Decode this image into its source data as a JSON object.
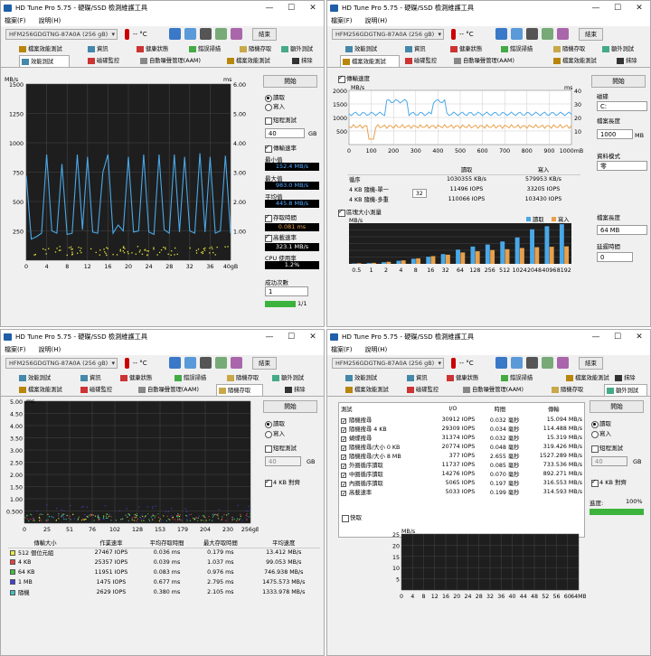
{
  "app": {
    "title": "HD Tune Pro 5.75 - 硬碟/SSD 檢測維護工具",
    "menu": [
      "檔案(F)",
      "說明(H)"
    ],
    "drive": "HFM256GDGTNG-87A0A (256 gB)",
    "temp": "-- °C",
    "exit_label": "結束"
  },
  "tabs": [
    "檔案效能測試",
    "資訊",
    "健康狀態",
    "錯誤掃描",
    "隨機存取",
    "額外測試",
    "效能測試",
    "磁碟監控",
    "自動噪聲管理(AAM)",
    "抹除"
  ],
  "colors": {
    "read": "#4aa8e8",
    "write": "#e8a04a",
    "bg": "#1e1e1e"
  },
  "win1": {
    "y_unit": "MB/s",
    "y2_unit": "ms",
    "yticks": [
      "1500",
      "1250",
      "1000",
      "750",
      "500",
      "250"
    ],
    "y2ticks": [
      "6.00",
      "5.00",
      "4.00",
      "3.00",
      "2.00",
      "1.00"
    ],
    "xticks": [
      "0",
      "4",
      "8",
      "12",
      "16",
      "20",
      "24",
      "28",
      "32",
      "36",
      "40gB"
    ],
    "start": "開始",
    "read": "讀取",
    "write": "寫入",
    "short": "短程測試",
    "short_val": "40",
    "short_unit": "GB",
    "transfer": "傳輸速率",
    "min_label": "最小值",
    "min": "152.4 MB/s",
    "max_label": "最大值",
    "max": "983.0 MB/s",
    "avg_label": "平均值",
    "avg": "445.8 MB/s",
    "access_label": "存取時間",
    "access": "0.081 ms",
    "burst_label": "高載速率",
    "burst": "323.1 MB/s",
    "cpu_label": "CPU 使用率",
    "cpu": "1.2%",
    "passes_label": "成功次數",
    "passes": "1",
    "progress": "1/1"
  },
  "win2": {
    "transfer": "傳輸速度",
    "y_unit": "MB/s",
    "y2_unit": "ms",
    "yticks": [
      "2000",
      "1500",
      "1000",
      "500"
    ],
    "y2ticks": [
      "40",
      "30",
      "20",
      "10"
    ],
    "xticks": [
      "0",
      "100",
      "200",
      "300",
      "400",
      "500",
      "600",
      "700",
      "800",
      "900",
      "1000mB"
    ],
    "table": {
      "headers": [
        "",
        "讀取",
        "寫入"
      ],
      "rows": [
        [
          "循序",
          "1030355 KB/s",
          "579953 KB/s"
        ],
        [
          "4 KB 隨機-單一",
          "11496 IOPS",
          "33205 IOPS"
        ],
        [
          "4 KB 隨機-多重",
          "110066 IOPS",
          "103430 IOPS"
        ]
      ],
      "queue": "32"
    },
    "block": "區塊大小測量",
    "bar_unit": "MB/s",
    "legend": [
      "讀取",
      "寫入"
    ],
    "categories": [
      "0.5",
      "1",
      "2",
      "4",
      "8",
      "16",
      "32",
      "64",
      "128",
      "256",
      "512",
      "1024",
      "2048",
      "4096",
      "8192"
    ],
    "start": "開始",
    "disk_label": "磁碟",
    "disk": "C:",
    "len_label": "檔案長度",
    "len": "1000",
    "len_unit": "MB",
    "mode_label": "資料模式",
    "mode": "零",
    "blk_label": "檔案長度",
    "blk": "64 MB",
    "delay_label": "延遲時間",
    "delay": "0"
  },
  "win3": {
    "y_unit": "ms",
    "yticks": [
      "5.00",
      "4.50",
      "4.00",
      "3.50",
      "3.00",
      "2.50",
      "2.00",
      "1.50",
      "1.00",
      "0.500"
    ],
    "xticks": [
      "0",
      "25",
      "51",
      "76",
      "102",
      "128",
      "153",
      "179",
      "204",
      "230",
      "256gB"
    ],
    "start": "開始",
    "read": "讀取",
    "write": "寫入",
    "short": "短程測試",
    "short_val": "40",
    "short_unit": "GB",
    "align": "4 KB 對齊",
    "headers": [
      "傳輸大小",
      "作業速率",
      "平均存取時間",
      "最大存取時間",
      "平均速度"
    ],
    "rows": [
      [
        "512 個位元組",
        "27467 IOPS",
        "0.036 ms",
        "0.179 ms",
        "13.412 MB/s"
      ],
      [
        "4 KB",
        "25357 IOPS",
        "0.039 ms",
        "1.037 ms",
        "99.053 MB/s"
      ],
      [
        "64 KB",
        "11951 IOPS",
        "0.083 ms",
        "0.976 ms",
        "746.938 MB/s"
      ],
      [
        "1 MB",
        "1475 IOPS",
        "0.677 ms",
        "2.795 ms",
        "1475.573 MB/s"
      ],
      [
        "隨機",
        "2629 IOPS",
        "0.380 ms",
        "2.105 ms",
        "1333.978 MB/s"
      ]
    ],
    "swatches": [
      "#e8e840",
      "#e84040",
      "#40c040",
      "#4040e0",
      "#40c0c0"
    ]
  },
  "win4": {
    "headers": [
      "測試",
      "I/O",
      "時間",
      "傳輸"
    ],
    "rows": [
      [
        "隨機搜尋",
        "30912 IOPS",
        "0.032 毫秒",
        "15.094 MB/s"
      ],
      [
        "隨機搜尋 4 KB",
        "29309 IOPS",
        "0.034 毫秒",
        "114.488 MB/s"
      ],
      [
        "蝴蝶搜尋",
        "31374 IOPS",
        "0.032 毫秒",
        "15.319 MB/s"
      ],
      [
        "隨機搜尋/大小 0 KB",
        "20774 IOPS",
        "0.048 毫秒",
        "319.426 MB/s"
      ],
      [
        "隨機搜尋/大小 8 MB",
        "377 IOPS",
        "2.655 毫秒",
        "1527.289 MB/s"
      ],
      [
        "外圈循序讀取",
        "11737 IOPS",
        "0.085 毫秒",
        "733.536 MB/s"
      ],
      [
        "中圈循序讀取",
        "14276 IOPS",
        "0.070 毫秒",
        "892.271 MB/s"
      ],
      [
        "內圈循序讀取",
        "5065 IOPS",
        "0.197 毫秒",
        "316.553 MB/s"
      ],
      [
        "高載速率",
        "5033 IOPS",
        "0.199 毫秒",
        "314.593 MB/s"
      ]
    ],
    "quick": "快取",
    "y_unit": "MB/s",
    "yticks": [
      "25",
      "20",
      "15",
      "10",
      "5"
    ],
    "xticks": [
      "0",
      "4",
      "8",
      "12",
      "16",
      "20",
      "24",
      "28",
      "32",
      "36",
      "40",
      "44",
      "48",
      "52",
      "56",
      "60",
      "64MB"
    ],
    "start": "開始",
    "read": "讀取",
    "write": "寫入",
    "short": "短程測試",
    "short_val": "40",
    "short_unit": "GB",
    "align": "4 KB 對齊",
    "progress_label": "進度:",
    "progress": "100%"
  },
  "chart_data": [
    {
      "type": "line",
      "title": "",
      "ylabel": "MB/s",
      "ylim": [
        0,
        1500
      ],
      "xlim": [
        0,
        40
      ],
      "series": [
        {
          "values": [
            720,
            180,
            200,
            230,
            900,
            250,
            230,
            820,
            220,
            230,
            900,
            260,
            880,
            240,
            230,
            750,
            900,
            230,
            300,
            250,
            880,
            240,
            250,
            900,
            240,
            220,
            900,
            260,
            230,
            900,
            240,
            880,
            250,
            230,
            910,
            240,
            880,
            230,
            250,
            890,
            230
          ]
        }
      ]
    },
    {
      "type": "bar",
      "title": "區塊大小測量",
      "ylabel": "MB/s",
      "categories": [
        "0.5",
        "1",
        "2",
        "4",
        "8",
        "16",
        "32",
        "64",
        "128",
        "256",
        "512",
        "1024",
        "2048",
        "4096",
        "8192"
      ],
      "series": [
        {
          "name": "讀取",
          "values": [
            20,
            40,
            80,
            150,
            250,
            350,
            480,
            700,
            850,
            950,
            1100,
            1300,
            1700,
            1850,
            1950
          ]
        },
        {
          "name": "寫入",
          "values": [
            30,
            50,
            100,
            170,
            270,
            380,
            450,
            560,
            620,
            680,
            720,
            780,
            820,
            840,
            860
          ]
        }
      ]
    }
  ]
}
